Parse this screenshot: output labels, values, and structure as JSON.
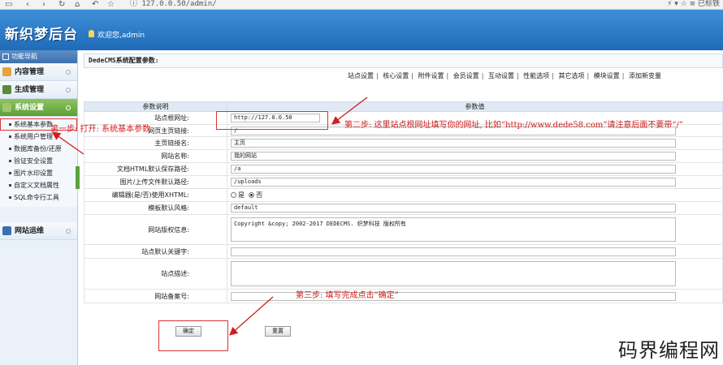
{
  "browser": {
    "url": "127.0.0.50/admin/",
    "right_text": "已标铁"
  },
  "header": {
    "logo": "新织梦后台",
    "welcome": "欢迎您,admin"
  },
  "sidebar": {
    "title": "功能导航",
    "categories": [
      {
        "label": "内容管理"
      },
      {
        "label": "生成管理"
      },
      {
        "label": "系统设置"
      }
    ],
    "items": [
      {
        "label": "系统基本参数"
      },
      {
        "label": "系统用户管理"
      },
      {
        "label": "数据库备份/还原"
      },
      {
        "label": "验证安全设置"
      },
      {
        "label": "图片水印设置"
      },
      {
        "label": "自定义文档属性"
      },
      {
        "label": "SQL命令行工具"
      }
    ],
    "bottom_category": "网站运维"
  },
  "main": {
    "config_title": "DedeCMS系统配置参数:",
    "tabs": [
      "站点设置",
      "核心设置",
      "附件设置",
      "会员设置",
      "互动设置",
      "性能选项",
      "其它选项",
      "模块设置",
      "添加新变量"
    ],
    "columns": [
      "参数说明",
      "参数值"
    ],
    "rows": [
      {
        "label": "站点根网址:",
        "value": "http://127.0.0.50"
      },
      {
        "label": "网页主页链接:",
        "value": "/"
      },
      {
        "label": "主页链接名:",
        "value": "主页"
      },
      {
        "label": "网站名称:",
        "value": "我的网站"
      },
      {
        "label": "文档HTML默认保存路径:",
        "value": "/a"
      },
      {
        "label": "图片/上传文件默认路径:",
        "value": "/uploads"
      },
      {
        "label": "编辑器(是/否)使用XHTML:",
        "opt_yes": "是",
        "opt_no": "否"
      },
      {
        "label": "模板默认风格:",
        "value": "default"
      },
      {
        "label": "网站版权信息:",
        "value": "Copyright &copy; 2002-2017 DEDECMS. 织梦科技 版权所有"
      },
      {
        "label": "站点默认关键字:",
        "value": ""
      },
      {
        "label": "站点描述:",
        "value": ""
      },
      {
        "label": "网站备案号:",
        "value": ""
      }
    ],
    "confirm_button": "确定",
    "reset_button": "重置"
  },
  "annotations": {
    "step1": "第一步: 打开: 系统基本参数",
    "step2": "第二步: 这里站点根网址填写你的网址, 比如“http://www.dede58.com”请注意后面不要带“/”",
    "step3": "第三步: 填写完成点击“确定”"
  },
  "watermark": "码界编程网",
  "colors": {
    "header_blue": "#2a7bc9",
    "active_green": "#6fae45",
    "annotation_red": "#d21c1c"
  }
}
